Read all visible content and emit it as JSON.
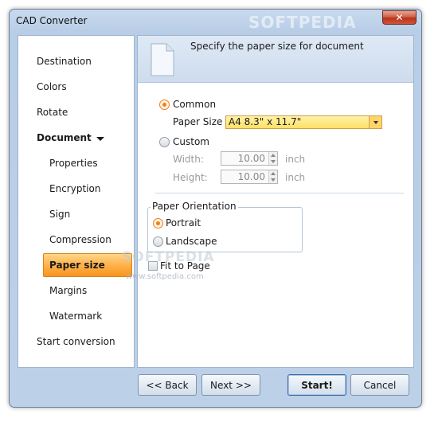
{
  "window": {
    "title": "CAD Converter",
    "watermark": "SOFTPEDIA",
    "close_glyph": "✕"
  },
  "sidebar": {
    "items": [
      {
        "label": "Destination"
      },
      {
        "label": "Colors"
      },
      {
        "label": "Rotate"
      },
      {
        "label": "Document"
      },
      {
        "label": "Properties"
      },
      {
        "label": "Encryption"
      },
      {
        "label": "Sign"
      },
      {
        "label": "Compression"
      },
      {
        "label": "Paper size"
      },
      {
        "label": "Margins"
      },
      {
        "label": "Watermark"
      },
      {
        "label": "Start conversion"
      }
    ],
    "selected": "Paper size",
    "expanded": "Document"
  },
  "header": {
    "text": "Specify the paper size for document",
    "icon": "document-icon"
  },
  "paper": {
    "common_label": "Common",
    "paper_size_label": "Paper Size",
    "paper_size_value": "A4 8.3\" x 11.7\"",
    "custom_label": "Custom",
    "width_label": "Width:",
    "width_value": "10.00",
    "height_label": "Height:",
    "height_value": "10.00",
    "unit": "inch",
    "mode": "Common"
  },
  "orientation": {
    "title": "Paper Orientation",
    "portrait_label": "Portrait",
    "landscape_label": "Landscape",
    "selected": "Portrait"
  },
  "fit_to_page": {
    "label": "Fit to Page",
    "checked": false
  },
  "watermark_overlay": {
    "text": "SOFTPEDIA",
    "url": "www.softpedia.com"
  },
  "buttons": {
    "back": "<< Back",
    "next": "Next >>",
    "start": "Start!",
    "cancel": "Cancel"
  },
  "colors": {
    "accent": "#f7951f",
    "selection": "#ffb24a",
    "frame": "#bcd0e7"
  }
}
